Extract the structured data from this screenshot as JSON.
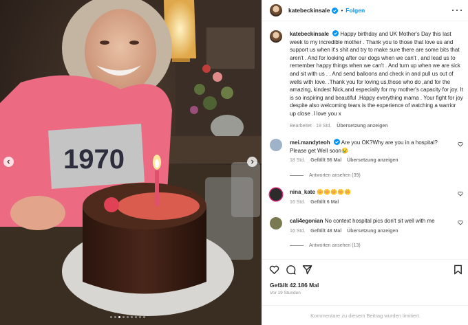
{
  "post": {
    "username": "katebeckinsale",
    "follow_label": "Folgen",
    "separator": "•"
  },
  "caption": {
    "username": "katebeckinsale",
    "text": "Happy birthday and UK Mother's Day this last week to my incredible mother . Thank you to those that love us and support us when it's shit and try to make sure there are some bits that aren't . And for looking after our dogs when we can't , and lead us to remember happy things when we can't . And turn up when we are sick and sit with us . . And send balloons and check in and pull us out of wells with love. .Thank you for loving us,those who do ,and for the amazing, kindest Nick,and especially for my mother's capacity for joy. It is so inspiring and beautiful .Happy everything mama . Your fight for joy despite also welcoming tears is the experience of watching a warrior up close .I love you x",
    "edited": "Bearbeitet · 19 Std.",
    "translate": "Übersetzung anzeigen"
  },
  "comments": [
    {
      "username": "mei.mandyteoh",
      "verified": true,
      "text": "Are you OK?Why are you in a hospital? Please get Well soon😢",
      "age": "18 Std.",
      "likes": "Gefällt 56 Mal",
      "translate": "Übersetzung anzeigen",
      "replies": "Antworten ansehen (39)",
      "avatar_color": "#9fb3c8"
    },
    {
      "username": "nina_kate",
      "verified": false,
      "text": "🌼🌼🌼🌼🌼",
      "age": "16 Std.",
      "likes": "Gefällt 6 Mal",
      "translate": "",
      "replies": "",
      "avatar_color": "#2b2b2b"
    },
    {
      "username": "cali4egonian",
      "verified": false,
      "text": "No context hospital pics don't sit well with me",
      "age": "16 Std.",
      "likes": "Gefällt 48 Mal",
      "translate": "Übersetzung anzeigen",
      "replies": "Antworten ansehen (13)",
      "avatar_color": "#7a7a52"
    }
  ],
  "engagement": {
    "likes": "Gefällt 42.186 Mal",
    "time": "Vor 19 Stunden",
    "comments_limited": "Kommentare zu diesem Beitrag wurden limitiert."
  },
  "icons": {
    "header_avatar": "avatar",
    "verified": "verified-badge-icon",
    "more": "more-options-icon",
    "like": "heart-icon",
    "comment": "comment-icon",
    "share": "share-icon",
    "save": "bookmark-icon",
    "prev": "chevron-left-icon",
    "next": "chevron-right-icon"
  },
  "carousel": {
    "total": 9,
    "current": 3
  },
  "colors": {
    "accent": "#0095f6",
    "text": "#262626",
    "secondary": "#8e8e8e"
  }
}
